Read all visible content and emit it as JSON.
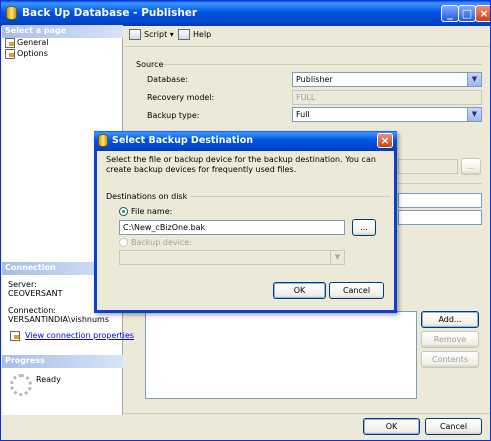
{
  "window": {
    "title": "Back Up Database - Publisher"
  },
  "sidebar": {
    "select_page_header": "Select a page",
    "pages": [
      {
        "label": "General"
      },
      {
        "label": "Options"
      }
    ],
    "connection_header": "Connection",
    "server_label": "Server:",
    "server_value": "CEOVERSANT",
    "connection_label": "Connection:",
    "connection_value": "VERSANTINDIA\\vishnums",
    "view_connection_link": "View connection properties",
    "progress_header": "Progress",
    "progress_status": "Ready"
  },
  "toolbar": {
    "script_label": "Script",
    "help_label": "Help"
  },
  "source": {
    "group_label": "Source",
    "database_label": "Database:",
    "database_value": "Publisher",
    "recovery_label": "Recovery model:",
    "recovery_value": "FULL",
    "backup_type_label": "Backup type:",
    "backup_type_value": "Full"
  },
  "destination": {
    "add_label": "Add...",
    "remove_label": "Remove",
    "contents_label": "Contents"
  },
  "footer": {
    "ok_label": "OK",
    "cancel_label": "Cancel"
  },
  "dialog": {
    "title": "Select Backup Destination",
    "description": "Select the file or backup device for the backup destination. You can create backup devices for frequently used files.",
    "group_label": "Destinations on disk",
    "file_name_label": "File name:",
    "file_name_value": "C:\\New_cBizOne.bak",
    "browse_label": "...",
    "backup_device_label": "Backup device:",
    "backup_device_value": "",
    "ok_label": "OK",
    "cancel_label": "Cancel"
  }
}
